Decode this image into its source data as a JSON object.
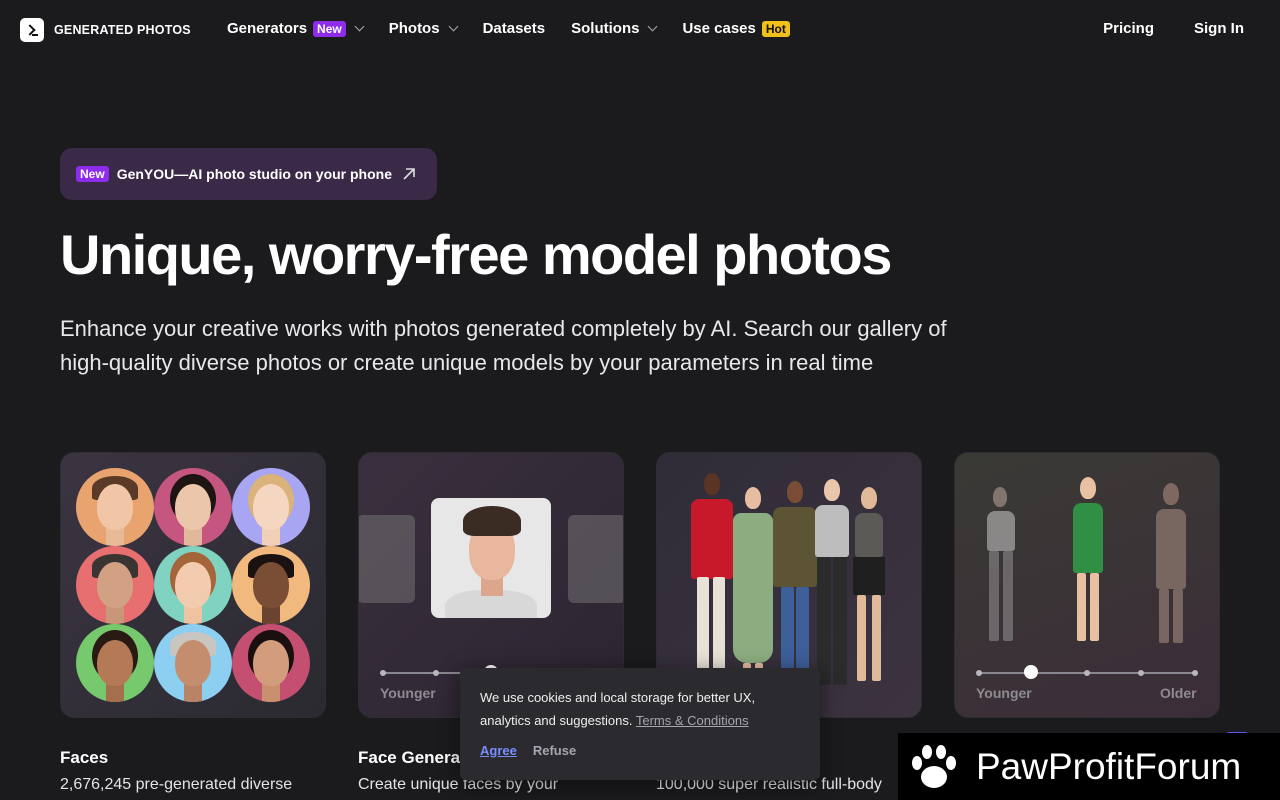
{
  "header": {
    "logo_text": "GENERATED PHOTOS",
    "nav": [
      {
        "label": "Generators",
        "badge": "New",
        "has_dropdown": true
      },
      {
        "label": "Photos",
        "badge": "",
        "has_dropdown": true
      },
      {
        "label": "Datasets",
        "badge": "",
        "has_dropdown": false
      },
      {
        "label": "Solutions",
        "badge": "",
        "has_dropdown": true
      },
      {
        "label": "Use cases",
        "badge": "Hot",
        "has_dropdown": false
      }
    ],
    "pricing": "Pricing",
    "sign_in": "Sign In"
  },
  "promo": {
    "badge": "New",
    "text": "GenYOU—AI photo studio on your phone",
    "icon": "arrow-up-right-icon"
  },
  "hero": {
    "title": "Unique, worry-free model photos",
    "lead_line1": "Enhance your creative works with photos generated completely by AI. Search our gallery of",
    "lead_line2": "high-quality diverse photos or create unique models by your parameters in real time"
  },
  "cards": [
    {
      "title": "Faces",
      "desc": "2,676,245 pre-generated diverse"
    },
    {
      "title": "Face Generat",
      "desc": "Create unique faces by your",
      "slider_left": "Younger"
    },
    {
      "title": "",
      "desc": "100,000 super realistic full-body"
    },
    {
      "title": "",
      "desc": "",
      "slider_left": "Younger",
      "slider_right": "Older"
    }
  ],
  "cookie": {
    "text_line1": "We use cookies and local storage for better UX,",
    "text_line2": "analytics and suggestions.",
    "terms": "Terms & Conditions",
    "agree": "Agree",
    "refuse": "Refuse"
  },
  "watermark": {
    "text": "PawProfitForum",
    "icon": "paw-icon"
  },
  "colors": {
    "accent_purple": "#8f2bea",
    "hot_yellow": "#f1c01b",
    "background": "#1b1a1d",
    "agree_link": "#7b8cff"
  }
}
